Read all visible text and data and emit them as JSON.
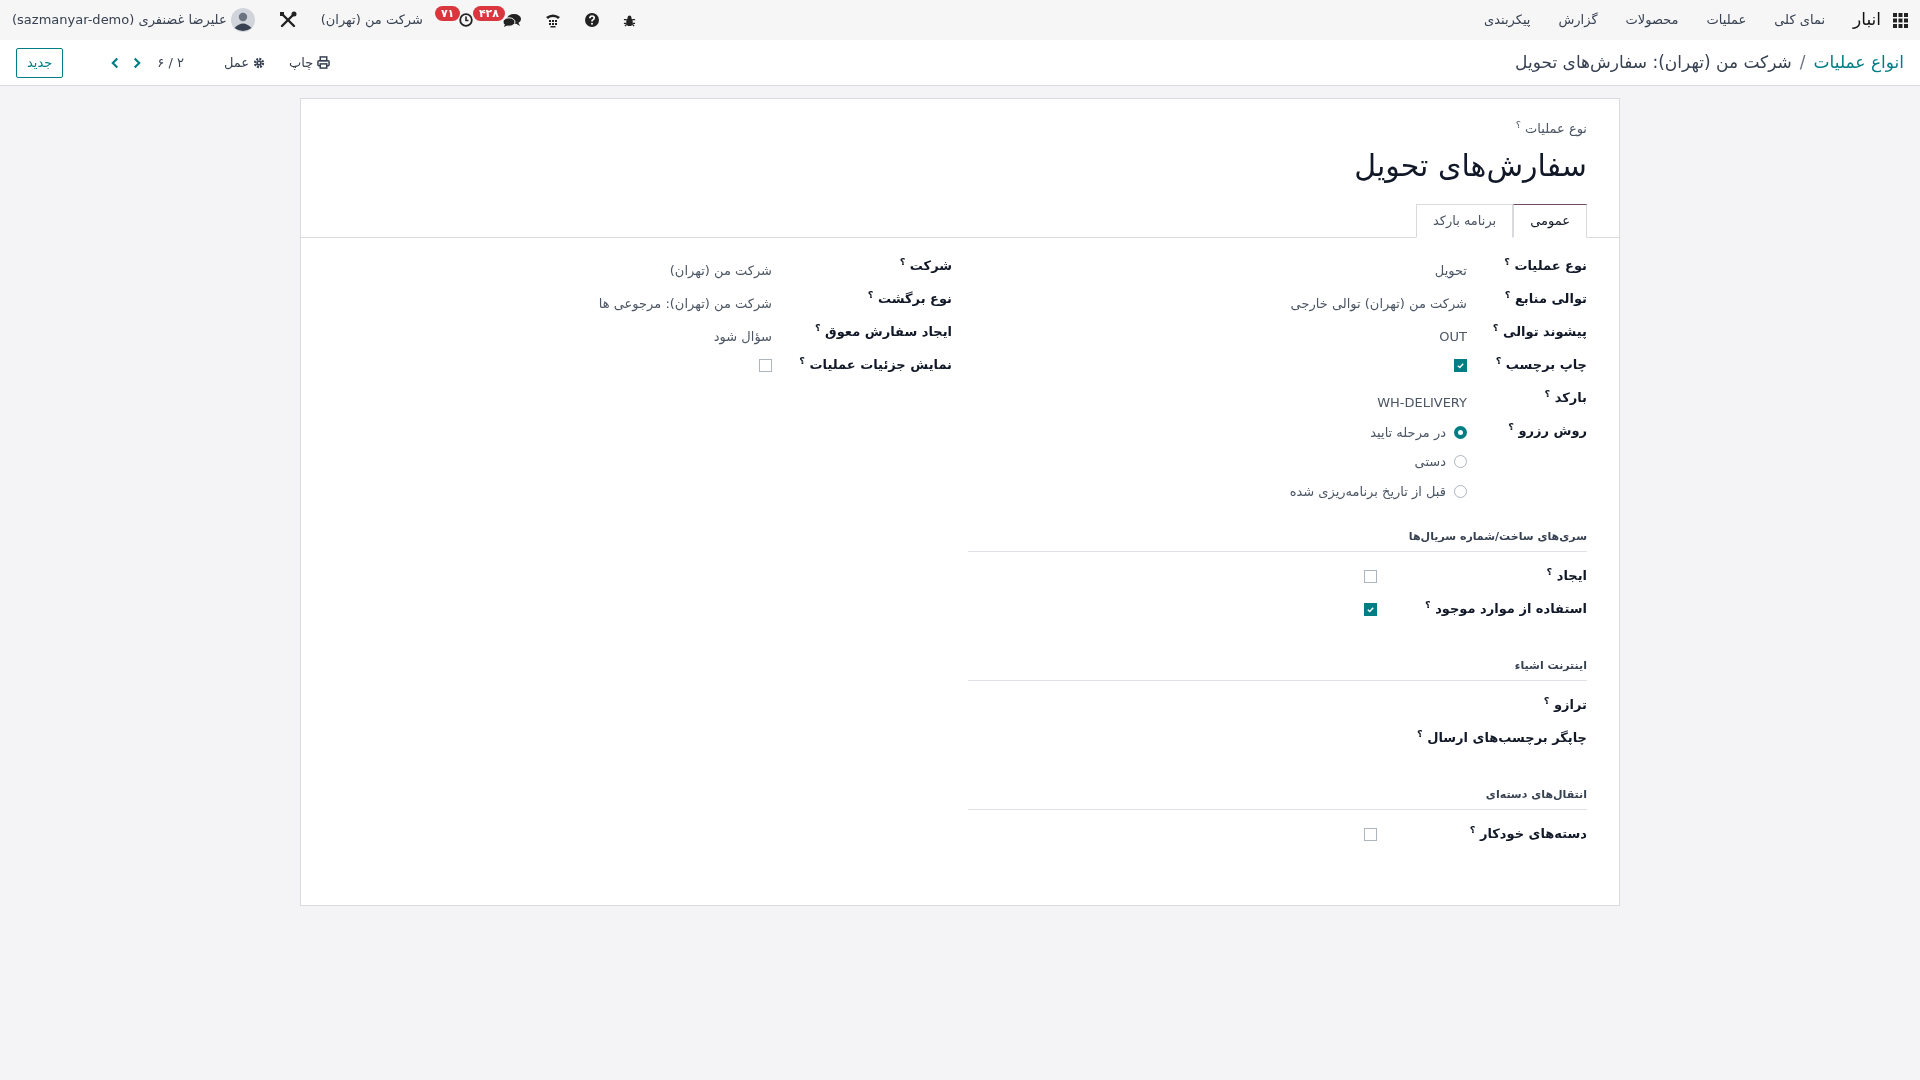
{
  "navbar": {
    "app_name": "انبار",
    "menu": [
      "نمای کلی",
      "عملیات",
      "محصولات",
      "گزارش",
      "پیکربندی"
    ],
    "systray": {
      "chat_count": "۴۲۸",
      "activity_count": "۷۱",
      "company": "شرکت من (تهران)",
      "user": "علیرضا غضنفری (sazmanyar-demo)"
    }
  },
  "control_panel": {
    "breadcrumb": [
      {
        "text": "انواع عملیات",
        "kind": "link"
      },
      {
        "text": "/",
        "kind": "separator"
      },
      {
        "text": "شرکت من (تهران): سفارش‌های تحویل",
        "kind": "current"
      }
    ],
    "print": "چاپ",
    "action": "عمل",
    "pager": "۲ / ۶",
    "new_button": "جدید"
  },
  "form": {
    "overline": "نوع عملیات $^{؟}$",
    "title": "سفارش‌های تحویل",
    "tabs": [
      {
        "label": "عمومی",
        "selected": true
      },
      {
        "label": "برنامه بارکد",
        "selected": false
      }
    ],
    "right_fields": [
      {
        "kind": "text",
        "label": "نوع عملیات $^{؟}$",
        "value": "تحویل"
      },
      {
        "kind": "text",
        "label": "توالی منابع $^{؟}$",
        "value": "شرکت من (تهران) توالی خارجی"
      },
      {
        "kind": "text",
        "label": "پیشوند توالی $^{؟}$",
        "value": "OUT"
      },
      {
        "kind": "checkbox",
        "label": "چاپ برچسب $^{؟}$",
        "checked": true
      },
      {
        "kind": "text",
        "label": "بارکد $^{؟}$",
        "value": "WH-DELIVERY"
      },
      {
        "kind": "radio",
        "label": "روش رزرو $^{؟}$",
        "options": [
          {
            "label": "در مرحله تایید",
            "selected": true
          },
          {
            "label": "دستی",
            "selected": false
          },
          {
            "label": "قبل از تاریخ برنامه‌ریزی شده",
            "selected": false
          }
        ]
      }
    ],
    "left_fields": [
      {
        "kind": "text",
        "label": "شرکت $^{؟}$",
        "value": "شرکت من (تهران)"
      },
      {
        "kind": "text",
        "label": "نوع برگشت $^{؟}$",
        "value": "شرکت من (تهران): مرجوعی ها"
      },
      {
        "kind": "text",
        "label": "ایجاد سفارش معوق $^{؟}$",
        "value": "سؤال شود"
      },
      {
        "kind": "checkbox",
        "label": "نمایش جزئیات عملیات $^{؟}$",
        "checked": false
      }
    ],
    "sections": [
      {
        "title": "سری‌های ساخت/شماره سریال‌ها",
        "fields": [
          {
            "kind": "checkbox",
            "label": "ایجاد $^{؟}$",
            "checked": false
          },
          {
            "kind": "checkbox",
            "label": "استفاده از موارد موجود $^{؟}$",
            "checked": true
          }
        ]
      },
      {
        "title": "اینترنت اشیاء",
        "fields": [
          {
            "kind": "empty",
            "label": "ترازو $^{؟}$"
          },
          {
            "kind": "empty",
            "label": "چاپگر برچسب‌های ارسال $^{؟}$"
          }
        ]
      },
      {
        "title": "انتقال‌های دسته‌ای",
        "fields": [
          {
            "kind": "checkbox",
            "label": "دسته‌های خودکار $^{؟}$",
            "checked": false
          }
        ]
      }
    ]
  }
}
